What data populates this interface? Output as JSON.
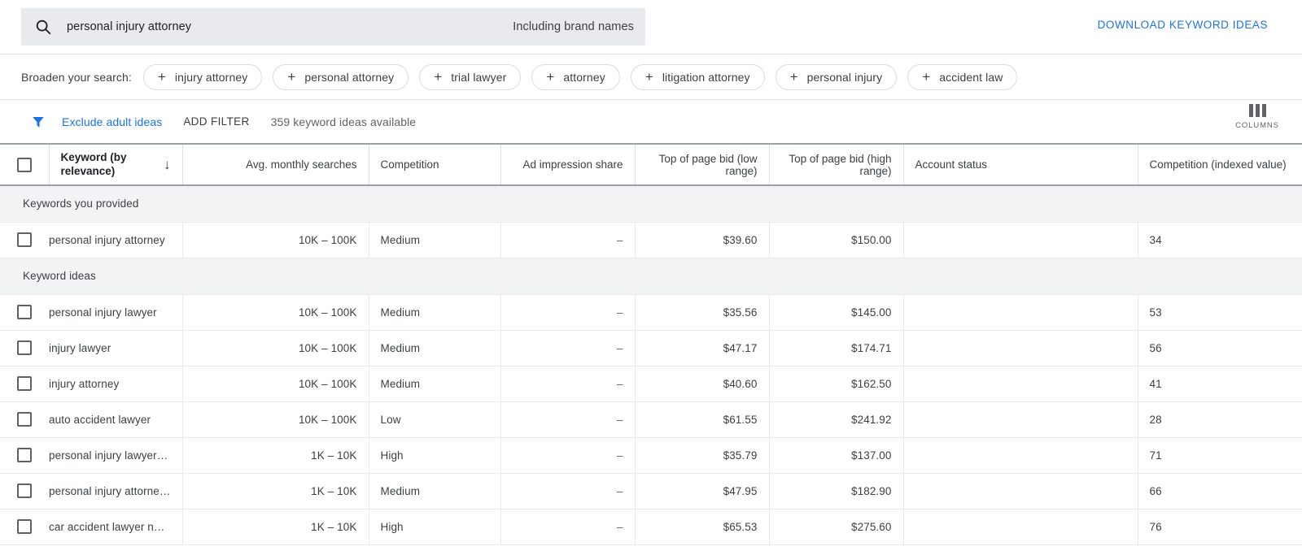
{
  "search": {
    "icon": "search-icon",
    "value": "personal injury attorney",
    "brand_toggle_label": "Including brand names"
  },
  "download_link": "DOWNLOAD KEYWORD IDEAS",
  "broaden": {
    "label": "Broaden your search:",
    "chips": [
      {
        "plus": "+",
        "label": "injury attorney"
      },
      {
        "plus": "+",
        "label": "personal attorney"
      },
      {
        "plus": "+",
        "label": "trial lawyer"
      },
      {
        "plus": "+",
        "label": "attorney"
      },
      {
        "plus": "+",
        "label": "litigation attorney"
      },
      {
        "plus": "+",
        "label": "personal injury"
      },
      {
        "plus": "+",
        "label": "accident law"
      }
    ]
  },
  "filterbar": {
    "funnel_icon": "filter-funnel-icon",
    "exclude_adult": "Exclude adult ideas",
    "add_filter": "ADD FILTER",
    "ideas_available": "359 keyword ideas available",
    "columns_label": "COLUMNS"
  },
  "table": {
    "columns": {
      "keyword": "Keyword (by relevance)",
      "sort_arrow": "↓",
      "avg_monthly_searches": "Avg. monthly searches",
      "competition": "Competition",
      "ad_impression_share": "Ad impression share",
      "top_bid_low": "Top of page bid (low range)",
      "top_bid_high": "Top of page bid (high range)",
      "account_status": "Account status",
      "competition_indexed": "Competition (indexed value)"
    },
    "sections": [
      {
        "title": "Keywords you provided",
        "rows": [
          {
            "keyword": "personal injury attorney",
            "avg_monthly_searches": "10K – 100K",
            "competition": "Medium",
            "ad_impression_share": "–",
            "top_bid_low": "$39.60",
            "top_bid_high": "$150.00",
            "account_status": "",
            "competition_indexed": "34"
          }
        ]
      },
      {
        "title": "Keyword ideas",
        "rows": [
          {
            "keyword": "personal injury lawyer",
            "avg_monthly_searches": "10K – 100K",
            "competition": "Medium",
            "ad_impression_share": "–",
            "top_bid_low": "$35.56",
            "top_bid_high": "$145.00",
            "account_status": "",
            "competition_indexed": "53"
          },
          {
            "keyword": "injury lawyer",
            "avg_monthly_searches": "10K – 100K",
            "competition": "Medium",
            "ad_impression_share": "–",
            "top_bid_low": "$47.17",
            "top_bid_high": "$174.71",
            "account_status": "",
            "competition_indexed": "56"
          },
          {
            "keyword": "injury attorney",
            "avg_monthly_searches": "10K – 100K",
            "competition": "Medium",
            "ad_impression_share": "–",
            "top_bid_low": "$40.60",
            "top_bid_high": "$162.50",
            "account_status": "",
            "competition_indexed": "41"
          },
          {
            "keyword": "auto accident lawyer",
            "avg_monthly_searches": "10K – 100K",
            "competition": "Low",
            "ad_impression_share": "–",
            "top_bid_low": "$61.55",
            "top_bid_high": "$241.92",
            "account_status": "",
            "competition_indexed": "28"
          },
          {
            "keyword": "personal injury lawyer n…",
            "avg_monthly_searches": "1K – 10K",
            "competition": "High",
            "ad_impression_share": "–",
            "top_bid_low": "$35.79",
            "top_bid_high": "$137.00",
            "account_status": "",
            "competition_indexed": "71"
          },
          {
            "keyword": "personal injury attorney …",
            "avg_monthly_searches": "1K – 10K",
            "competition": "Medium",
            "ad_impression_share": "–",
            "top_bid_low": "$47.95",
            "top_bid_high": "$182.90",
            "account_status": "",
            "competition_indexed": "66"
          },
          {
            "keyword": "car accident lawyer nea…",
            "avg_monthly_searches": "1K – 10K",
            "competition": "High",
            "ad_impression_share": "–",
            "top_bid_low": "$65.53",
            "top_bid_high": "$275.60",
            "account_status": "",
            "competition_indexed": "76"
          }
        ]
      }
    ]
  },
  "colors": {
    "accent_blue": "#1a73e8",
    "search_bg": "#e8eaed",
    "section_bg": "#f1f3f4",
    "text_primary": "#202124",
    "text_secondary": "#5f6368"
  }
}
